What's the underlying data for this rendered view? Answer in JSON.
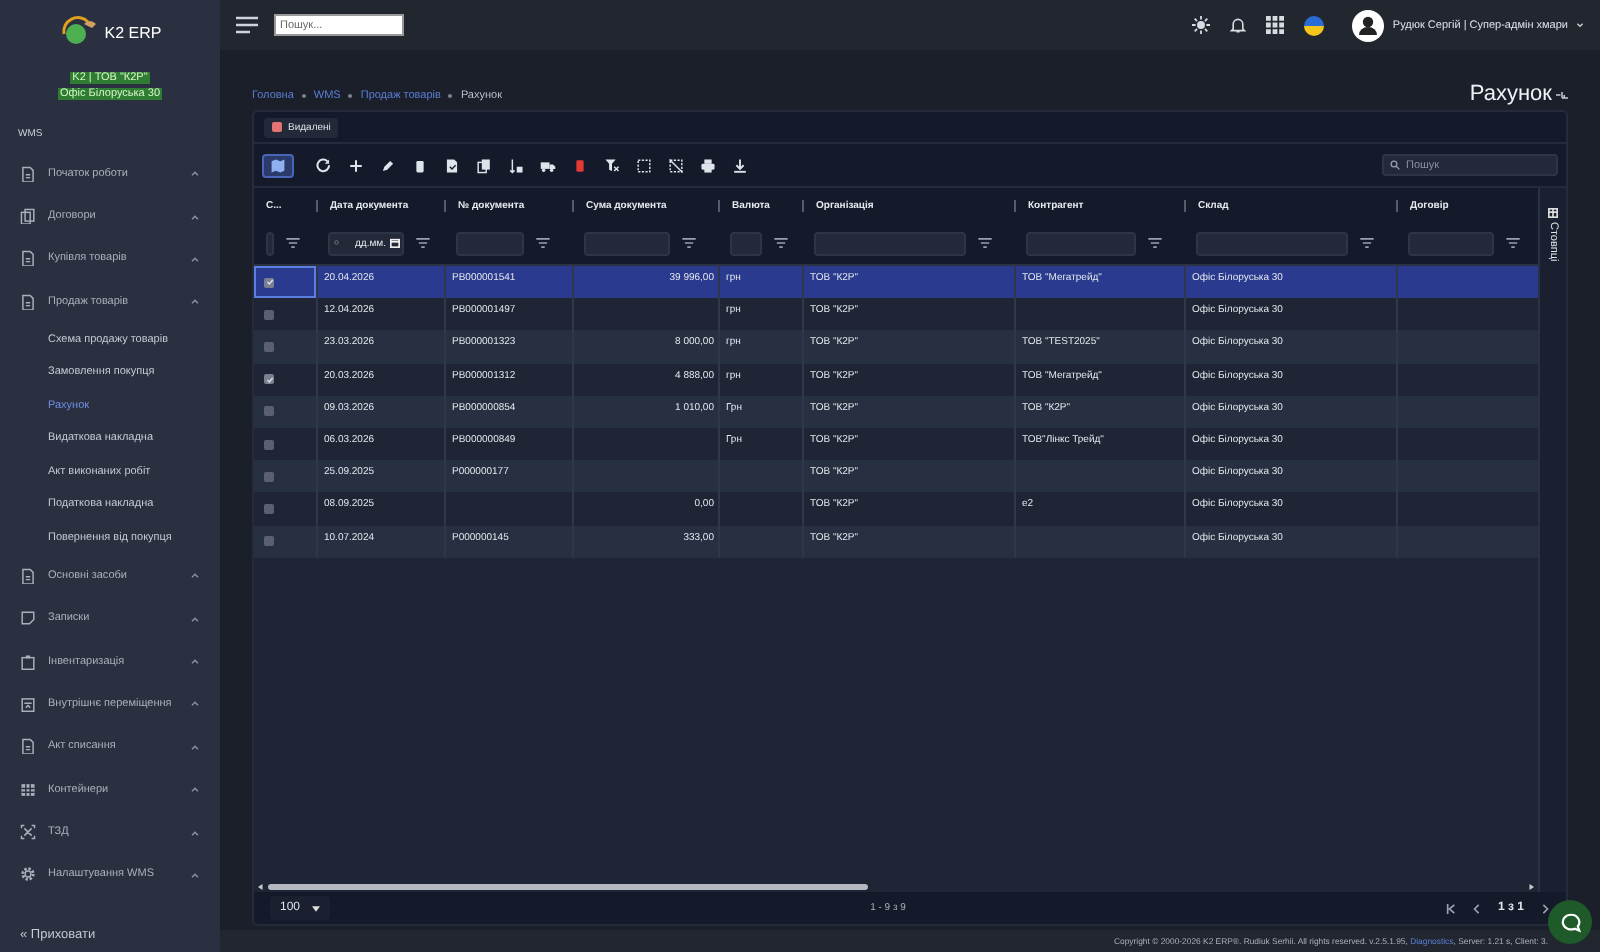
{
  "sidebar": {
    "brand": "K2 ERP",
    "company": "K2 | ТОВ \"К2Р\"",
    "office": "Офіс Білоруська 30",
    "section": "WMS",
    "items": [
      {
        "label": "Початок роботи",
        "kind": "doc"
      },
      {
        "label": "Договори",
        "kind": "docs"
      },
      {
        "label": "Купівля товарів",
        "kind": "doc"
      },
      {
        "label": "Продаж товарів",
        "kind": "doc",
        "children": [
          {
            "label": "Схема продажу товарів",
            "selected": false
          },
          {
            "label": "Замовлення покупця",
            "selected": false
          },
          {
            "label": "Рахунок",
            "selected": true
          },
          {
            "label": "Видаткова накладна",
            "selected": false
          },
          {
            "label": "Акт виконаних робіт",
            "selected": false
          },
          {
            "label": "Податкова накладна",
            "selected": false
          },
          {
            "label": "Повернення від покупця",
            "selected": false
          }
        ]
      },
      {
        "label": "Основні засоби",
        "kind": "doc"
      },
      {
        "label": "Записки",
        "kind": "note"
      },
      {
        "label": "Інвентаризація",
        "kind": "clip"
      },
      {
        "label": "Внутрішнє переміщення",
        "kind": "cal"
      },
      {
        "label": "Акт списання",
        "kind": "doc"
      },
      {
        "label": "Контейнери",
        "kind": "grid"
      },
      {
        "label": "ТЗД",
        "kind": "scan"
      },
      {
        "label": "Налаштування WMS",
        "kind": "gear"
      }
    ],
    "collapse": "« Приховати"
  },
  "topbar": {
    "search": {
      "placeholder": "Пошук..."
    },
    "user": "Рудюк Сергій | Супер-адмін хмари"
  },
  "breadcrumbs": [
    "Головна",
    "WMS",
    "Продаж товарів",
    "Рахунок"
  ],
  "title": "Рахунок",
  "legend": {
    "label": "Видалені",
    "color": "#e57373"
  },
  "grid_search": {
    "placeholder": "Пошук"
  },
  "columns": [
    {
      "label": "С...",
      "kind": "narrow"
    },
    {
      "label": "Дата документа",
      "kind": "date",
      "placeholder": "дд.мм."
    },
    {
      "label": "№ документа",
      "kind": "text"
    },
    {
      "label": "Сума документа",
      "kind": "text"
    },
    {
      "label": "Валюта",
      "kind": "narrow"
    },
    {
      "label": "Організація",
      "kind": "text"
    },
    {
      "label": "Контрагент",
      "kind": "text"
    },
    {
      "label": "Склад",
      "kind": "text"
    },
    {
      "label": "Договір",
      "kind": "text"
    }
  ],
  "rows": [
    {
      "checked": true,
      "selected": true,
      "date": "20.04.2026",
      "number": "РВ000001541",
      "sum": "39 996,00",
      "currency": "грн",
      "organization": "ТОВ \"К2Р\"",
      "counterparty": "ТОВ \"Мегатрейд\"",
      "warehouse": "Офіс Білоруська 30"
    },
    {
      "checked": false,
      "selected": false,
      "date": "12.04.2026",
      "number": "РВ000001497",
      "currency": "грн",
      "organization": "ТОВ \"К2Р\"",
      "warehouse": "Офіс Білоруська 30"
    },
    {
      "checked": false,
      "selected": false,
      "date": "23.03.2026",
      "number": "РВ000001323",
      "sum": "8 000,00",
      "currency": "грн",
      "organization": "ТОВ \"К2Р\"",
      "counterparty": "ТОВ \"TEST2025\"",
      "warehouse": "Офіс Білоруська 30"
    },
    {
      "checked": true,
      "selected": false,
      "date": "20.03.2026",
      "number": "РВ000001312",
      "sum": "4 888,00",
      "currency": "грн",
      "organization": "ТОВ \"К2Р\"",
      "counterparty": "ТОВ \"Мегатрейд\"",
      "warehouse": "Офіс Білоруська 30"
    },
    {
      "checked": false,
      "selected": false,
      "date": "09.03.2026",
      "number": "РВ000000854",
      "sum": "1 010,00",
      "currency": "Грн",
      "organization": "ТОВ \"К2Р\"",
      "counterparty": "ТОВ \"К2Р\"",
      "warehouse": "Офіс Білоруська 30"
    },
    {
      "checked": false,
      "selected": false,
      "date": "06.03.2026",
      "number": "РВ000000849",
      "currency": "Грн",
      "organization": "ТОВ \"К2Р\"",
      "counterparty": "ТОВ\"Лінкс Трейд\"",
      "warehouse": "Офіс Білоруська 30"
    },
    {
      "checked": false,
      "selected": false,
      "date": "25.09.2025",
      "number": "Р000000177",
      "organization": "ТОВ \"К2Р\"",
      "warehouse": "Офіс Білоруська 30"
    },
    {
      "checked": false,
      "selected": false,
      "date": "08.09.2025",
      "sum": "0,00",
      "organization": "ТОВ \"К2Р\"",
      "counterparty": "е2",
      "warehouse": "Офіс Білоруська 30"
    },
    {
      "checked": false,
      "selected": false,
      "date": "10.07.2024",
      "number": "Р000000145",
      "sum": "333,00",
      "organization": "ТОВ \"К2Р\"",
      "warehouse": "Офіс Білоруська 30"
    }
  ],
  "columns_panel": "Стовпці",
  "pager": {
    "page_size": "100",
    "range": "1 - 9 з 9",
    "pages": "1 з 1"
  },
  "footer": {
    "text": "Copyright © 2000-2026 K2 ERP®. Rudiuk Serhii. All rights reserved. v.2.5.1.95,",
    "link": "Diagnostics",
    "timing": ", Server: 1.21 s, Client: 3."
  }
}
